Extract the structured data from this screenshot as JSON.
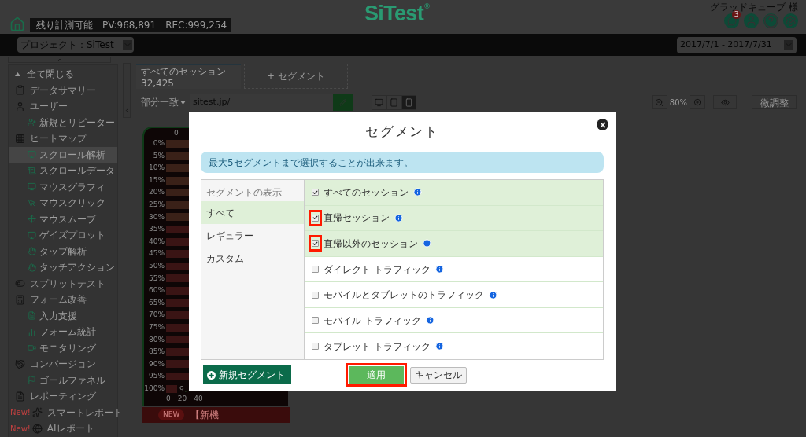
{
  "header": {
    "quota_label": "残り計測可能",
    "pv": "PV:968,891",
    "rec": "REC:999,254",
    "logo": "SiTest",
    "logo_mark": "®",
    "user": "グラッドキューブ 様",
    "notification_count": "3"
  },
  "toolbar": {
    "project": "プロジェクト：SiTest",
    "date_range": "2017/7/1 - 2017/7/31"
  },
  "sidebar": {
    "collapse_all": "全て閉じる",
    "items": [
      {
        "label": "データサマリー",
        "selected": false
      },
      {
        "label": "ユーザー",
        "selected": false,
        "children": [
          {
            "label": "新規とリピーター",
            "selected": false
          }
        ]
      },
      {
        "label": "ヒートマップ",
        "selected": false,
        "children": [
          {
            "label": "スクロール解析",
            "selected": true
          },
          {
            "label": "スクロールデータ",
            "selected": false
          },
          {
            "label": "マウスグラフィ",
            "selected": false
          },
          {
            "label": "マウスクリック",
            "selected": false
          },
          {
            "label": "マウスムーブ",
            "selected": false
          },
          {
            "label": "ゲイズプロット",
            "selected": false
          },
          {
            "label": "タップ解析",
            "selected": false
          },
          {
            "label": "タッチアクション",
            "selected": false
          }
        ]
      },
      {
        "label": "スプリットテスト",
        "selected": false
      },
      {
        "label": "フォーム改善",
        "selected": false,
        "children": [
          {
            "label": "入力支援",
            "selected": false
          },
          {
            "label": "フォーム統計",
            "selected": false
          },
          {
            "label": "モニタリング",
            "selected": false
          }
        ]
      },
      {
        "label": "コンバージョン",
        "selected": false,
        "children": [
          {
            "label": "ゴールファネル",
            "selected": false
          }
        ]
      },
      {
        "label": "レポーティング",
        "selected": false
      },
      {
        "label": "スマートレポート",
        "selected": false,
        "badge": "New!"
      },
      {
        "label": "AIレポート",
        "selected": false,
        "badge": "New!"
      }
    ]
  },
  "segment_tabs": [
    {
      "label": "すべてのセッション",
      "count": "32,425",
      "kind": "segment"
    },
    {
      "label": "+ セグメント",
      "kind": "add"
    }
  ],
  "filter": {
    "match": "部分一致",
    "url": "sitest.jp/",
    "devices": [
      {
        "kind": "desktop",
        "selected": false
      },
      {
        "kind": "tablet",
        "selected": false
      },
      {
        "kind": "phone",
        "selected": true
      }
    ],
    "zoom": "80%",
    "adjust": "微調整"
  },
  "heatmap": {
    "top_label": "0",
    "row_labels": [
      "0%",
      "5%",
      "10%",
      "15%",
      "20%",
      "25%",
      "30%",
      "35%",
      "40%",
      "45%",
      "50%",
      "55%",
      "60%",
      "65%",
      "70%",
      "75%",
      "80%",
      "85%",
      "90%",
      "95%",
      "100%"
    ],
    "axis_labels": [
      "0",
      "20",
      "40"
    ],
    "point_label": "9",
    "news_badge": "NEW",
    "news_text": "【新機"
  },
  "modal": {
    "title": "セグメント",
    "notice": "最大5セグメントまで選択することが出来ます。",
    "categories_header": "セグメントの表示",
    "categories": [
      {
        "label": "すべて",
        "selected": true
      },
      {
        "label": "レギュラー",
        "selected": false
      },
      {
        "label": "カスタム",
        "selected": false
      }
    ],
    "segments": [
      {
        "label": "すべてのセッション",
        "checked": true,
        "highlighted": false
      },
      {
        "label": "直帰セッション",
        "checked": true,
        "highlighted": true
      },
      {
        "label": "直帰以外のセッション",
        "checked": true,
        "highlighted": true
      },
      {
        "label": "ダイレクト トラフィック",
        "checked": false,
        "highlighted": false
      },
      {
        "label": "モバイルとタブレットのトラフィック",
        "checked": false,
        "highlighted": false
      },
      {
        "label": "モバイル トラフィック",
        "checked": false,
        "highlighted": false
      },
      {
        "label": "タブレット トラフィック",
        "checked": false,
        "highlighted": false
      }
    ],
    "new_segment": "新規セグメント",
    "apply": "適用",
    "apply_highlighted": true,
    "cancel": "キャンセル"
  }
}
